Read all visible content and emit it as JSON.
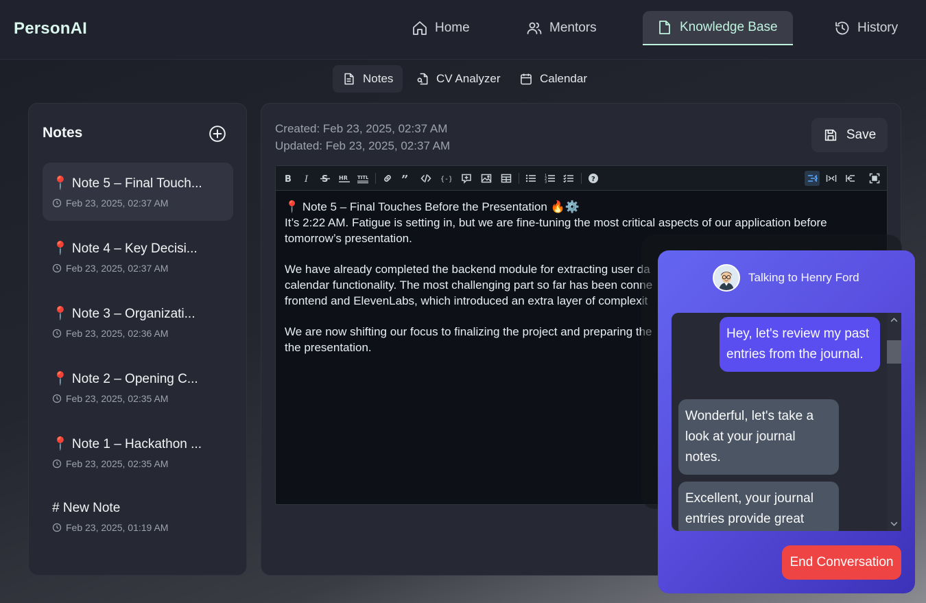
{
  "app": {
    "brand": "PersonAI"
  },
  "nav": {
    "home": "Home",
    "mentors": "Mentors",
    "knowledge_base": "Knowledge Base",
    "history": "History"
  },
  "subtabs": {
    "notes": "Notes",
    "cv_analyzer": "CV Analyzer",
    "calendar": "Calendar"
  },
  "notes_panel": {
    "title": "Notes",
    "items": [
      {
        "title": "📍 Note 5 – Final Touch...",
        "date": "Feb 23, 2025, 02:37 AM"
      },
      {
        "title": "📍 Note 4 – Key Decisi...",
        "date": "Feb 23, 2025, 02:37 AM"
      },
      {
        "title": "📍 Note 3 – Organizati...",
        "date": "Feb 23, 2025, 02:36 AM"
      },
      {
        "title": "📍 Note 2 – Opening C...",
        "date": "Feb 23, 2025, 02:35 AM"
      },
      {
        "title": "📍 Note 1 – Hackathon ...",
        "date": "Feb 23, 2025, 02:35 AM"
      },
      {
        "title": "# New Note",
        "date": "Feb 23, 2025, 01:19 AM"
      }
    ]
  },
  "editor": {
    "created": "Created: Feb 23, 2025, 02:37 AM",
    "updated": "Updated: Feb 23, 2025, 02:37 AM",
    "save_label": "Save",
    "content": {
      "heading": "📍 Note 5 – Final Touches Before the Presentation 🔥⚙️",
      "p1a": "It’s 2:22 AM. Fatigue is setting in, but we are fine-tuning the most critical aspects of our application before",
      "p1b": "tomorrow’s presentation.",
      "p2a": "We have already completed the backend module for extracting user da",
      "p2b": "calendar functionality. The most challenging part so far has been conne",
      "p2c": "frontend and ElevenLabs, which introduced an extra layer of complexit",
      "p3a": "We are now shifting our focus to finalizing the project and preparing the",
      "p3b": "the presentation."
    }
  },
  "chat": {
    "header": "Talking to Henry Ford",
    "messages": [
      {
        "role": "user",
        "text": "Hey, let's review my past entries from the journal."
      },
      {
        "role": "assistant",
        "text": "Wonderful, let's take a look at your journal notes."
      },
      {
        "role": "assistant",
        "text": "Excellent, your journal entries provide great"
      }
    ],
    "end_label": "End Conversation"
  },
  "colors": {
    "brand": "#d9f7ec",
    "chat_gradient_start": "#6366f1",
    "chat_gradient_end": "#3c32b8",
    "user_bubble": "#5b4ef0",
    "bot_bubble": "#4b5563",
    "end_button": "#ef4444"
  }
}
